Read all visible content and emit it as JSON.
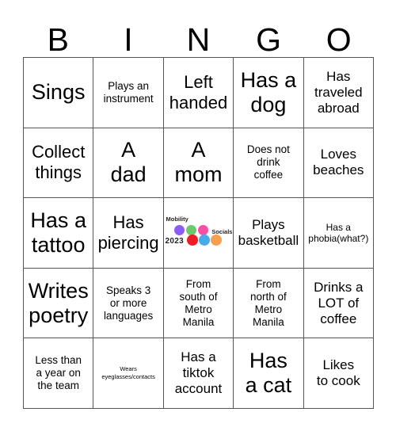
{
  "card": {
    "title_letters": [
      "B",
      "I",
      "N",
      "G",
      "O"
    ]
  },
  "logo": {
    "word_top": "Mobility",
    "word_right": "Socials",
    "year": "2023",
    "dots": [
      {
        "name": "purple",
        "color": "#8b5cf6"
      },
      {
        "name": "green",
        "color": "#6cc96c"
      },
      {
        "name": "pink",
        "color": "#f94fa4"
      },
      {
        "name": "red",
        "color": "#ee1c25"
      },
      {
        "name": "blue",
        "color": "#4aa9e8"
      },
      {
        "name": "orange",
        "color": "#f5a04f"
      }
    ]
  },
  "grid": {
    "rows": [
      [
        {
          "text": "Sings",
          "size": "xl"
        },
        {
          "text": "Plays an\ninstrument",
          "size": "sm"
        },
        {
          "text": "Left\nhanded",
          "size": "lg"
        },
        {
          "text": "Has a\ndog",
          "size": "xl"
        },
        {
          "text": "Has\ntraveled\nabroad",
          "size": "md"
        }
      ],
      [
        {
          "text": "Collect\nthings",
          "size": "lg"
        },
        {
          "text": "A\ndad",
          "size": "xl"
        },
        {
          "text": "A\nmom",
          "size": "xl"
        },
        {
          "text": "Does not\ndrink\ncoffee",
          "size": "sm"
        },
        {
          "text": "Loves\nbeaches",
          "size": "md"
        }
      ],
      [
        {
          "text": "Has a\ntattoo",
          "size": "xl"
        },
        {
          "text": "Has\npiercing",
          "size": "lg"
        },
        {
          "text": "",
          "size": "logo"
        },
        {
          "text": "Plays\nbasketball",
          "size": "md"
        },
        {
          "text": "Has a\nphobia(what?)",
          "size": "xs"
        }
      ],
      [
        {
          "text": "Writes\npoetry",
          "size": "xl"
        },
        {
          "text": "Speaks 3\nor more\nlanguages",
          "size": "sm"
        },
        {
          "text": "From\nsouth of\nMetro\nManila",
          "size": "sm"
        },
        {
          "text": "From\nnorth of\nMetro\nManila",
          "size": "sm"
        },
        {
          "text": "Drinks a\nLOT of\ncoffee",
          "size": "md"
        }
      ],
      [
        {
          "text": "Less than\na year on\nthe team",
          "size": "sm"
        },
        {
          "text": "Wears\neyeglasses/contacts",
          "size": "xxs"
        },
        {
          "text": "Has a\ntiktok\naccount",
          "size": "md"
        },
        {
          "text": "Has\na cat",
          "size": "xl"
        },
        {
          "text": "Likes\nto cook",
          "size": "md"
        }
      ]
    ]
  }
}
